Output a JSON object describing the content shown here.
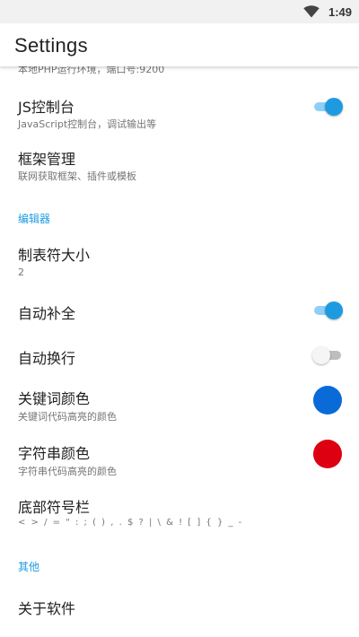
{
  "status_bar": {
    "time": "1:49"
  },
  "app_bar": {
    "title": "Settings"
  },
  "partial_summary": "本地PHP运行环境，端口号:9200",
  "general": {
    "js_console": {
      "title": "JS控制台",
      "summary": "JavaScript控制台，调试输出等",
      "enabled": true
    },
    "framework": {
      "title": "框架管理",
      "summary": "联网获取框架、插件或模板"
    }
  },
  "editor": {
    "category": "编辑器",
    "tab_size": {
      "title": "制表符大小",
      "summary": "2"
    },
    "auto_complete": {
      "title": "自动补全",
      "enabled": true
    },
    "word_wrap": {
      "title": "自动换行",
      "enabled": false
    },
    "keyword_color": {
      "title": "关键词颜色",
      "summary": "关键词代码高亮的颜色",
      "color": "#0a6ad8"
    },
    "string_color": {
      "title": "字符串颜色",
      "summary": "字符串代码高亮的颜色",
      "color": "#dd0010"
    },
    "symbol_bar": {
      "title": "底部符号栏",
      "summary": "< > / = \" : ; ( ) , . $ ? | \\ & ! [ ] { } _ -"
    }
  },
  "other": {
    "category": "其他",
    "about": {
      "title": "关于软件"
    }
  },
  "colors": {
    "accent": "#1e9be0",
    "accent_light": "#8ed0f5"
  }
}
